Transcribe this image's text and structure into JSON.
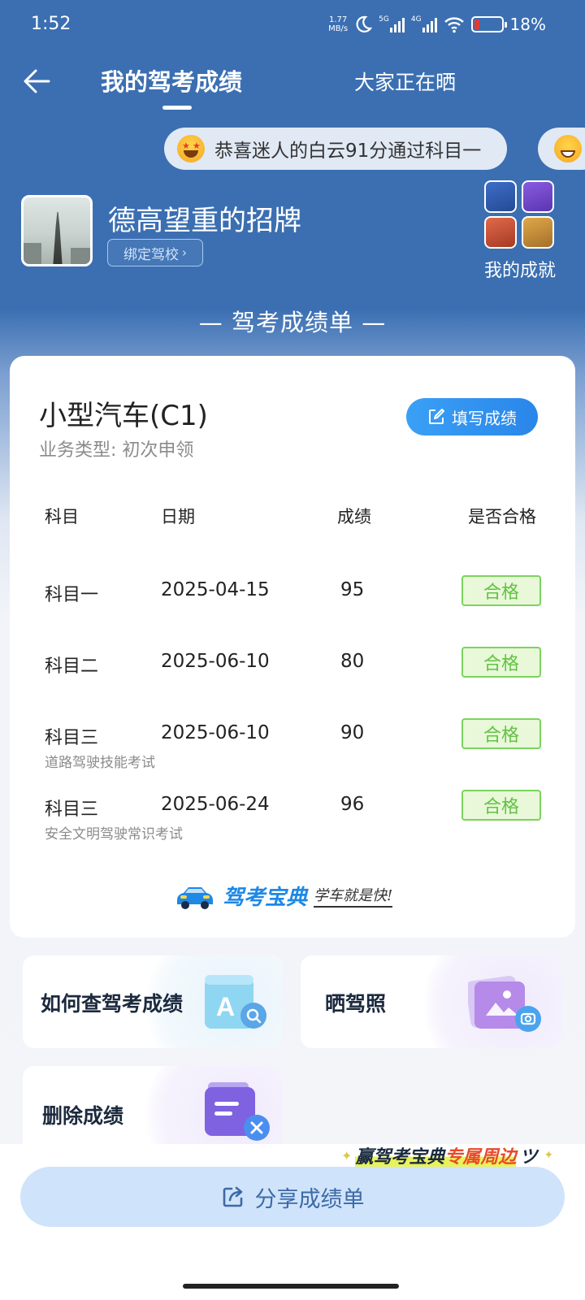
{
  "status_bar": {
    "time": "1:52",
    "net_speed_value": "1.77",
    "net_speed_unit": "MB/s",
    "signal_1": "5G",
    "signal_2": "4G",
    "battery": "18%"
  },
  "header": {
    "tab_active": "我的驾考成绩",
    "tab_inactive": "大家正在晒"
  },
  "ticker": {
    "message": "恭喜迷人的白云91分通过科目一"
  },
  "profile": {
    "nickname": "德高望重的招牌",
    "bind_school": "绑定驾校",
    "achievements_label": "我的成就"
  },
  "section_title": "— 驾考成绩单 —",
  "card": {
    "vehicle": "小型汽车(C1)",
    "business_type": "业务类型: 初次申领",
    "fill_button": "填写成绩",
    "headers": [
      "科目",
      "日期",
      "成绩",
      "是否合格"
    ],
    "rows": [
      {
        "subject": "科目一",
        "date": "2025-04-15",
        "score": "95",
        "result": "合格",
        "note": ""
      },
      {
        "subject": "科目二",
        "date": "2025-06-10",
        "score": "80",
        "result": "合格",
        "note": ""
      },
      {
        "subject": "科目三",
        "date": "2025-06-10",
        "score": "90",
        "result": "合格",
        "note": "道路驾驶技能考试"
      },
      {
        "subject": "科目三",
        "date": "2025-06-24",
        "score": "96",
        "result": "合格",
        "note": "安全文明驾驶常识考试"
      }
    ],
    "brand_name": "驾考宝典",
    "brand_slogan": "学车就是快!"
  },
  "tiles": {
    "query": "如何查驾考成绩",
    "license": "晒驾照",
    "delete": "删除成绩"
  },
  "promo": {
    "part1": "赢驾考宝典",
    "part2": "专属周边"
  },
  "share_button": "分享成绩单",
  "colors": {
    "primary_blue": "#3b6fb2",
    "pass_green": "#62c244",
    "button_blue": "#2a86ea"
  }
}
